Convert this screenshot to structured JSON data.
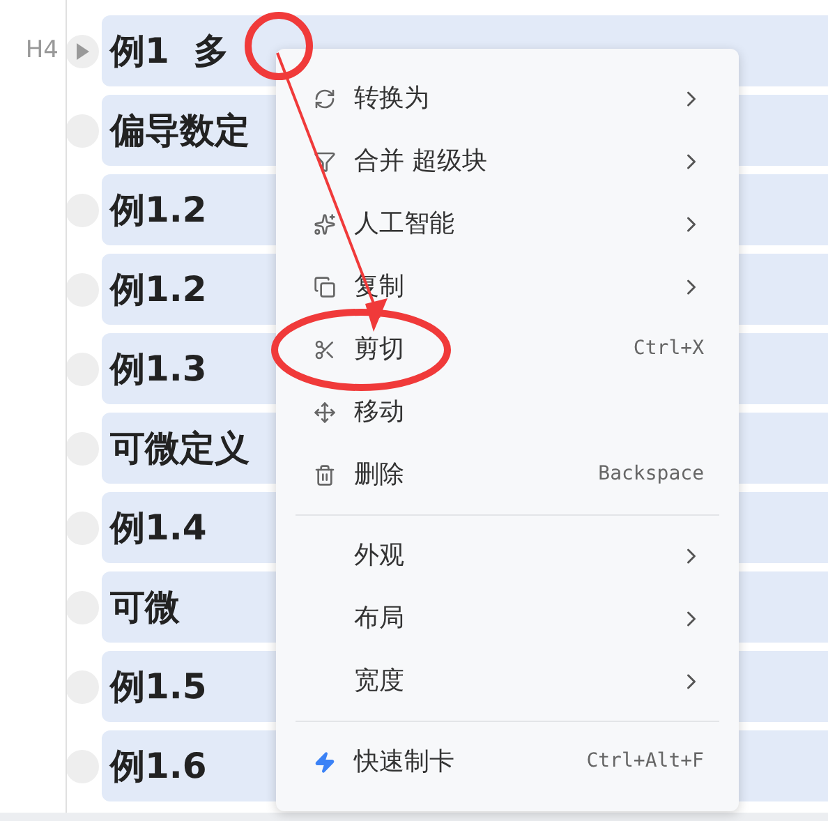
{
  "blocks": [
    {
      "kind": "heading",
      "level_label": "H4",
      "text": "例1  多"
    },
    {
      "kind": "bullet",
      "text": "偏导数定"
    },
    {
      "kind": "bullet",
      "text": "例1.2"
    },
    {
      "kind": "bullet",
      "text": "例1.2"
    },
    {
      "kind": "bullet",
      "text": "例1.3"
    },
    {
      "kind": "bullet",
      "text": "可微定义"
    },
    {
      "kind": "bullet",
      "text": "例1.4"
    },
    {
      "kind": "bullet",
      "text": "可微"
    },
    {
      "kind": "bullet",
      "text": "例1.5"
    },
    {
      "kind": "bullet",
      "text": "例1.6"
    }
  ],
  "context_menu": {
    "sections": [
      [
        {
          "label": "转换为",
          "submenu": true
        },
        {
          "label": "合并 超级块",
          "submenu": true
        },
        {
          "label": "人工智能",
          "submenu": true
        },
        {
          "label": "复制",
          "submenu": true
        },
        {
          "label": "剪切",
          "shortcut": "Ctrl+X",
          "submenu": false
        },
        {
          "label": "移动",
          "submenu": false
        },
        {
          "label": "删除",
          "shortcut": "Backspace",
          "submenu": false
        }
      ],
      [
        {
          "label": "外观",
          "submenu": true
        },
        {
          "label": "布局",
          "submenu": true
        },
        {
          "label": "宽度",
          "submenu": true
        }
      ],
      [
        {
          "label": "快速制卡",
          "shortcut": "Ctrl+Alt+F",
          "submenu": false
        }
      ]
    ]
  }
}
